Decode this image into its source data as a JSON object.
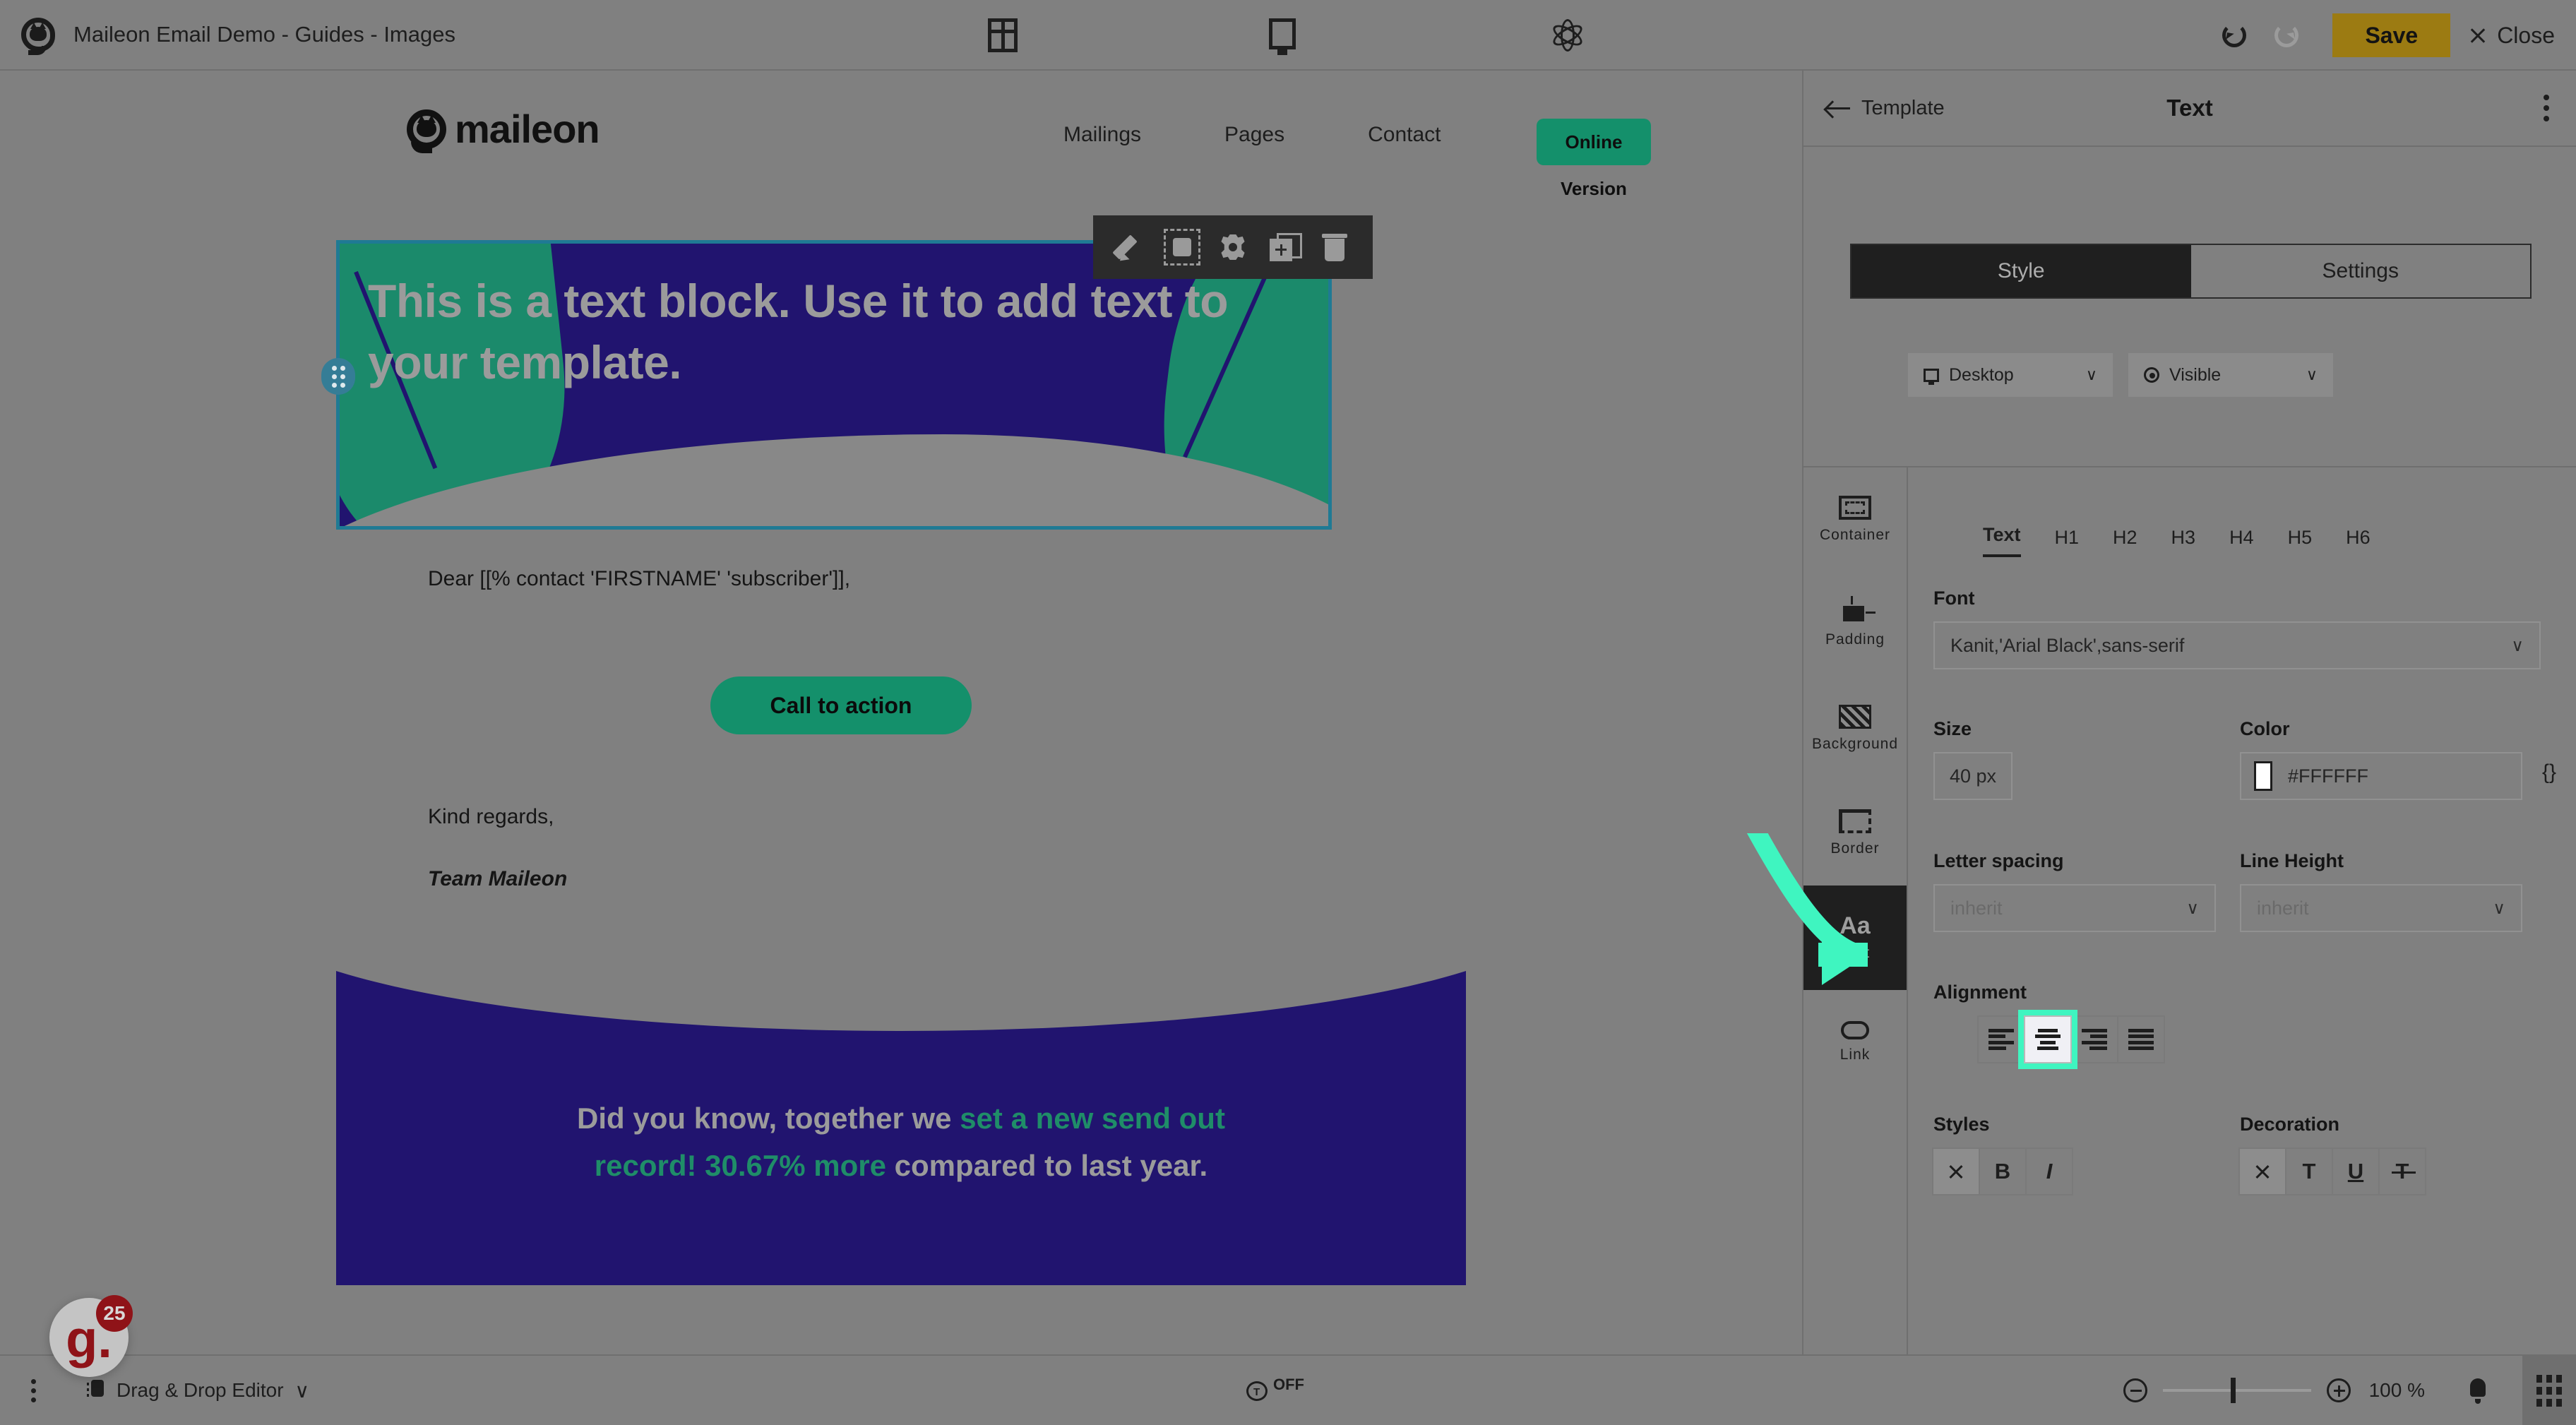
{
  "topbar": {
    "doc_title": "Maileon Email Demo - Guides - Images",
    "logo_icon": "maileon-cat-icon",
    "layout_icon": "layout-columns-icon",
    "desktop_icon": "desktop-preview-icon",
    "atom_icon": "atom-personalization-icon",
    "undo_icon": "undo-icon",
    "redo_icon": "redo-icon",
    "save_label": "Save",
    "close_label": "Close",
    "close_icon": "close-x-icon",
    "save_color": "#9C7B12"
  },
  "block_toolbar": {
    "edit_icon": "pencil-edit-icon",
    "select_icon": "select-container-icon",
    "settings_icon": "gear-settings-icon",
    "duplicate_icon": "duplicate-add-icon",
    "delete_icon": "trash-delete-icon"
  },
  "email": {
    "logo_word": "maileon",
    "nav": [
      "Mailings",
      "Pages",
      "Contact"
    ],
    "online_version_label": "Online Version",
    "hero_text": "This is a text block. Use it to add text to your template.",
    "hero_bg_color": "#21146F",
    "hero_accent_color": "#1B8A6B",
    "selection_border_color": "#1F7A94",
    "drag_handle_icon": "drag-handle-icon",
    "greeting": "Dear [[% contact 'FIRSTNAME' 'subscriber']],",
    "cta_label": "Call to action",
    "cta_color": "#14906B",
    "regards": "Kind regards,",
    "signature": "Team Maileon",
    "promo_line1_a": "Did you know, together we ",
    "promo_line1_b": "set a new send out",
    "promo_line2_a": "record! 30.67% more",
    "promo_line2_b": " compared to last year.",
    "promo_highlight_color": "#1F8D68"
  },
  "panel": {
    "back_label": "Template",
    "back_icon": "back-arrow-icon",
    "title": "Text",
    "kebab_icon": "more-options-icon",
    "tabs": [
      {
        "label": "Style",
        "active": true
      },
      {
        "label": "Settings",
        "active": false
      }
    ],
    "device_chip": {
      "label": "Desktop",
      "icon": "monitor-icon",
      "chevron": "∨"
    },
    "visibility_chip": {
      "label": "Visible",
      "icon": "eye-icon",
      "chevron": "∨"
    },
    "side_tabs": [
      {
        "label": "Container",
        "icon": "container-icon",
        "active": false
      },
      {
        "label": "Padding",
        "icon": "padding-icon",
        "active": false
      },
      {
        "label": "Background",
        "icon": "background-icon",
        "active": false
      },
      {
        "label": "Border",
        "icon": "border-icon",
        "active": false
      },
      {
        "label": "Text",
        "icon": "text-aa-icon",
        "active": true
      },
      {
        "label": "Link",
        "icon": "link-icon",
        "active": false
      }
    ],
    "text_aa_glyph": "Aa",
    "tag_tabs": [
      {
        "label": "Text",
        "active": true
      },
      {
        "label": "H1",
        "active": false
      },
      {
        "label": "H2",
        "active": false
      },
      {
        "label": "H3",
        "active": false
      },
      {
        "label": "H4",
        "active": false
      },
      {
        "label": "H5",
        "active": false
      },
      {
        "label": "H6",
        "active": false
      }
    ],
    "font": {
      "label": "Font",
      "value": "Kanit,'Arial Black',sans-serif",
      "chevron": "∨"
    },
    "size": {
      "label": "Size",
      "value": "40 px"
    },
    "color": {
      "label": "Color",
      "value": "#FFFFFF",
      "swatch": "#FFFFFF",
      "braces": "{}"
    },
    "letter_spacing": {
      "label": "Letter spacing",
      "value": "inherit",
      "chevron": "∨"
    },
    "line_height": {
      "label": "Line Height",
      "value": "inherit",
      "chevron": "∨"
    },
    "alignment": {
      "label": "Alignment",
      "options": [
        {
          "name": "align-left",
          "selected": false
        },
        {
          "name": "align-center",
          "selected": true
        },
        {
          "name": "align-right",
          "selected": false
        },
        {
          "name": "align-justify",
          "selected": false
        }
      ]
    },
    "styles": {
      "label": "Styles",
      "options": [
        {
          "name": "none",
          "glyph": "×",
          "selected": true
        },
        {
          "name": "bold",
          "glyph": "B",
          "selected": false
        },
        {
          "name": "italic",
          "glyph": "I",
          "selected": false
        }
      ]
    },
    "decoration": {
      "label": "Decoration",
      "options": [
        {
          "name": "none",
          "glyph": "×",
          "selected": true
        },
        {
          "name": "text",
          "glyph": "T",
          "selected": false
        },
        {
          "name": "underline",
          "glyph": "U",
          "selected": false
        },
        {
          "name": "strikethrough",
          "glyph": "T",
          "selected": false
        }
      ]
    },
    "highlight_color": "#3FF5C0"
  },
  "bottombar": {
    "kebab_icon": "more-options-icon",
    "editor_label": "Drag & Drop Editor",
    "editor_icon": "drag-drop-icon",
    "editor_chevron": "∨",
    "toggle_icon": "auto-save-toggle-icon",
    "toggle_state": "OFF",
    "zoom_out_icon": "zoom-out-icon",
    "zoom_in_icon": "zoom-in-icon",
    "zoom_value": "100 %",
    "bell_icon": "notification-bell-icon",
    "apps_icon": "apps-grid-icon"
  },
  "widget": {
    "letter": "g.",
    "badge_count": "25",
    "brand_color": "#8F1318"
  }
}
